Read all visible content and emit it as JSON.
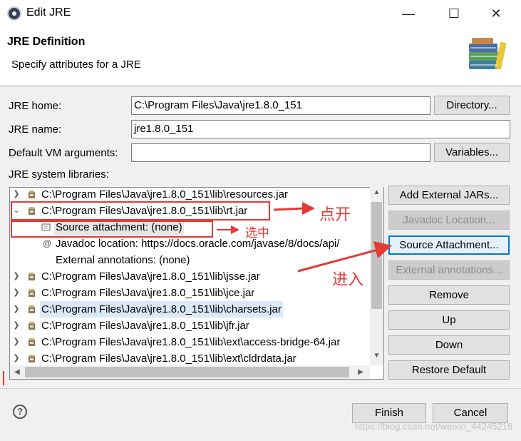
{
  "window": {
    "title": "Edit JRE"
  },
  "header": {
    "title": "JRE Definition",
    "description": "Specify attributes for a JRE"
  },
  "form": {
    "jre_home_label": "JRE home:",
    "jre_home_value": "C:\\Program Files\\Java\\jre1.8.0_151",
    "directory_button": "Directory...",
    "jre_name_label": "JRE name:",
    "jre_name_value": "jre1.8.0_151",
    "vm_args_label": "Default VM arguments:",
    "vm_args_value": "",
    "variables_button": "Variables...",
    "libraries_label": "JRE system libraries:"
  },
  "libraries": [
    {
      "label": "C:\\Program Files\\Java\\jre1.8.0_151\\lib\\resources.jar",
      "expanded": false
    },
    {
      "label": "C:\\Program Files\\Java\\jre1.8.0_151\\lib\\rt.jar",
      "expanded": true
    },
    {
      "label": "Source attachment: (none)",
      "child": true
    },
    {
      "label": "Javadoc location: https://docs.oracle.com/javase/8/docs/api/",
      "child": true
    },
    {
      "label": "External annotations: (none)",
      "child": true
    },
    {
      "label": "C:\\Program Files\\Java\\jre1.8.0_151\\lib\\jsse.jar",
      "expanded": false
    },
    {
      "label": "C:\\Program Files\\Java\\jre1.8.0_151\\lib\\jce.jar",
      "expanded": false
    },
    {
      "label": "C:\\Program Files\\Java\\jre1.8.0_151\\lib\\charsets.jar",
      "expanded": false,
      "selected": true
    },
    {
      "label": "C:\\Program Files\\Java\\jre1.8.0_151\\lib\\jfr.jar",
      "expanded": false
    },
    {
      "label": "C:\\Program Files\\Java\\jre1.8.0_151\\lib\\ext\\access-bridge-64.jar",
      "expanded": false
    },
    {
      "label": "C:\\Program Files\\Java\\jre1.8.0_151\\lib\\ext\\cldrdata.jar",
      "expanded": false
    }
  ],
  "side_buttons": {
    "add_external_jars": "Add External JARs...",
    "javadoc_location": "Javadoc Location...",
    "source_attachment": "Source Attachment...",
    "external_annotations": "External annotations...",
    "remove": "Remove",
    "up": "Up",
    "down": "Down",
    "restore_default": "Restore Default"
  },
  "footer": {
    "finish": "Finish",
    "cancel": "Cancel",
    "help_icon": "?"
  },
  "annotations": {
    "expand_note": "点开",
    "select_note": "选中",
    "enter_note": "进入",
    "color": "#e53935"
  },
  "watermark": "https://blog.csdn.net/weixin_44245216",
  "icons": {
    "app": "eclipse-icon",
    "jar": "jar-icon",
    "source": "source-attachment-icon",
    "javadoc": "javadoc-icon",
    "books": "books-icon"
  }
}
